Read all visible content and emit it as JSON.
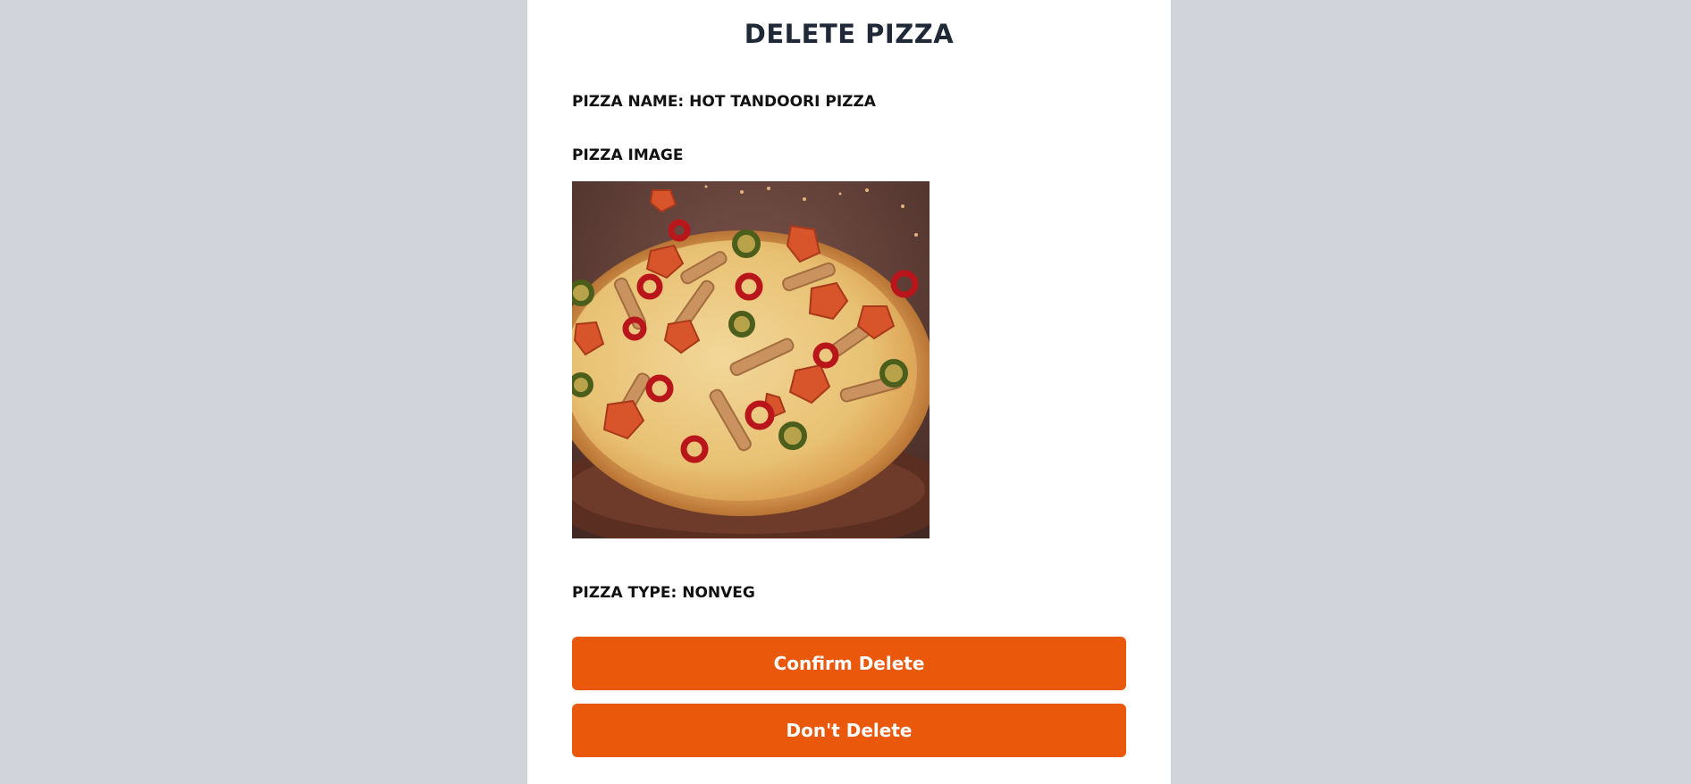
{
  "page": {
    "title": "DELETE PIZZA"
  },
  "pizza": {
    "name_label": "PIZZA NAME:",
    "name": "HOT TANDOORI PIZZA",
    "image_label": "PIZZA IMAGE",
    "type_label": "PIZZA TYPE:",
    "type": "NONVEG",
    "image_alt": "Hot Tandoori Pizza"
  },
  "actions": {
    "confirm_label": "Confirm Delete",
    "cancel_label": "Don't Delete"
  },
  "colors": {
    "page_background": "#d1d5db",
    "card_background": "#ffffff",
    "title_text": "#1f2937",
    "button_background": "#ea580c",
    "button_text": "#ffffff"
  }
}
